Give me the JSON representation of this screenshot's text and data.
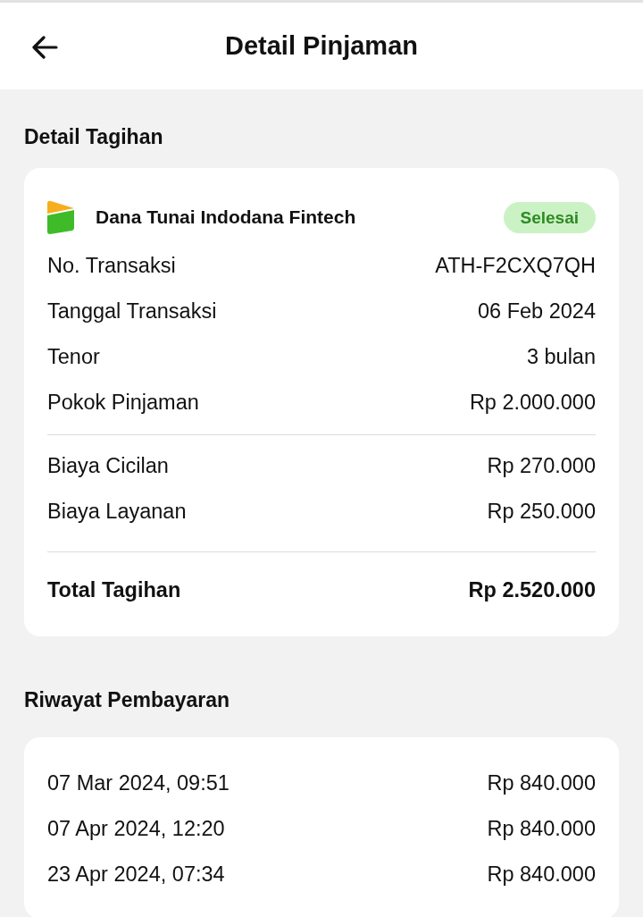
{
  "header": {
    "title": "Detail Pinjaman"
  },
  "bill": {
    "title": "Detail Tagihan",
    "provider": "Dana Tunai Indodana Fintech",
    "status": "Selesai",
    "detail_groups": [
      {
        "rows": [
          {
            "label": "No. Transaksi",
            "value": "ATH-F2CXQ7QH"
          },
          {
            "label": "Tanggal Transaksi",
            "value": "06 Feb 2024"
          },
          {
            "label": "Tenor",
            "value": "3 bulan"
          },
          {
            "label": "Pokok Pinjaman",
            "value": "Rp 2.000.000"
          }
        ]
      },
      {
        "rows": [
          {
            "label": "Biaya Cicilan",
            "value": "Rp 270.000"
          },
          {
            "label": "Biaya Layanan",
            "value": "Rp 250.000"
          }
        ]
      }
    ],
    "total": {
      "label": "Total Tagihan",
      "value": "Rp 2.520.000"
    }
  },
  "payment_history": {
    "title": "Riwayat Pembayaran",
    "rows": [
      {
        "date": "07 Mar 2024, 09:51",
        "amount": "Rp 840.000"
      },
      {
        "date": "07 Apr 2024, 12:20",
        "amount": "Rp 840.000"
      },
      {
        "date": "23 Apr 2024, 07:34",
        "amount": "Rp 840.000"
      }
    ]
  }
}
